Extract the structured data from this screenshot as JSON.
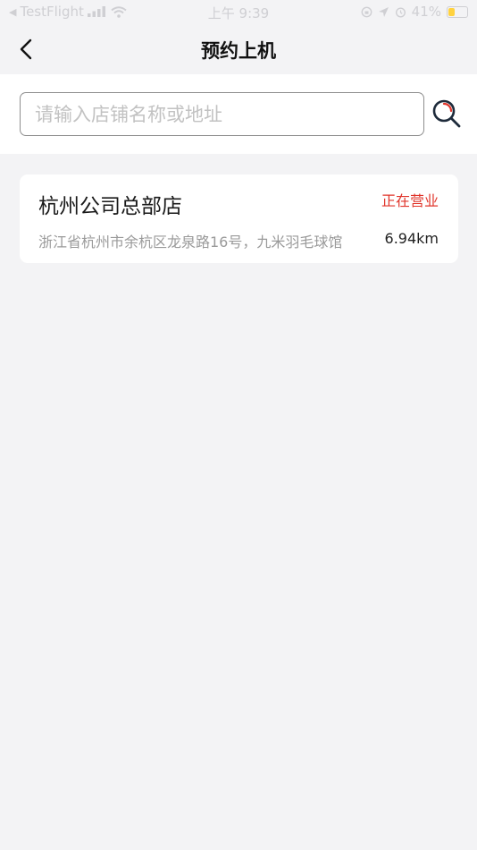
{
  "status_bar": {
    "back_app": "TestFlight",
    "time": "上午 9:39",
    "battery": "41%",
    "battery_level": 0.41,
    "battery_color": "#ffd23f"
  },
  "nav": {
    "title": "预约上机",
    "back_icon": "chevron-left-icon"
  },
  "search": {
    "placeholder": "请输入店铺名称或地址",
    "value": "",
    "icon": "search-icon",
    "icon_color": "#1d2a3a",
    "icon_accent": "#e0352b"
  },
  "stores": [
    {
      "name": "杭州公司总部店",
      "status": "正在营业",
      "address": "浙江省杭州市余杭区龙泉路16号，九米羽毛球馆",
      "distance": "6.94km"
    }
  ],
  "colors": {
    "background": "#f3f3f5",
    "card": "#ffffff",
    "status_open": "#e0352b"
  }
}
